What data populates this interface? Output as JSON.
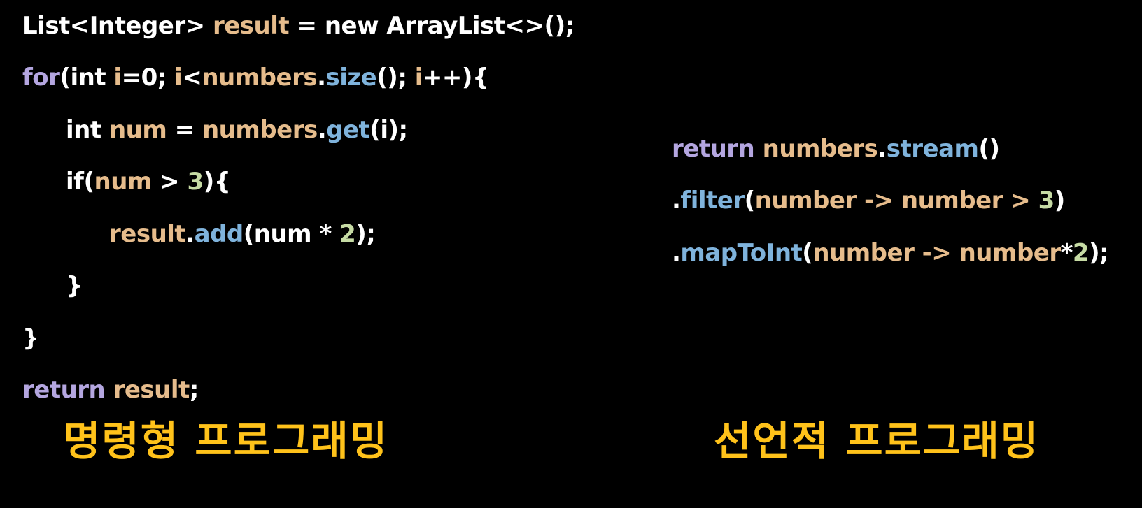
{
  "colors": {
    "background": "#000000",
    "plain": "#ffffff",
    "keyword": "#b4a6e0",
    "variable": "#e6bc8c",
    "method": "#7fb3dc",
    "number": "#c6dba4",
    "caption": "#ffc21a"
  },
  "imperative": {
    "lines": [
      [
        {
          "text": "List<Integer> ",
          "kind": "plain"
        },
        {
          "text": "result",
          "kind": "variable"
        },
        {
          "text": " = new ArrayList<>();",
          "kind": "plain"
        }
      ],
      [
        {
          "text": "for",
          "kind": "keyword"
        },
        {
          "text": "(int ",
          "kind": "plain"
        },
        {
          "text": "i",
          "kind": "variable"
        },
        {
          "text": "=0; ",
          "kind": "plain"
        },
        {
          "text": "i",
          "kind": "variable"
        },
        {
          "text": "<",
          "kind": "plain"
        },
        {
          "text": "numbers",
          "kind": "variable"
        },
        {
          "text": ".",
          "kind": "plain"
        },
        {
          "text": "size",
          "kind": "method"
        },
        {
          "text": "(); ",
          "kind": "plain"
        },
        {
          "text": "i",
          "kind": "variable"
        },
        {
          "text": "++){",
          "kind": "plain"
        }
      ],
      [
        {
          "text": "int ",
          "kind": "plain"
        },
        {
          "text": "num",
          "kind": "variable"
        },
        {
          "text": " = ",
          "kind": "plain"
        },
        {
          "text": "numbers",
          "kind": "variable"
        },
        {
          "text": ".",
          "kind": "plain"
        },
        {
          "text": "get",
          "kind": "method"
        },
        {
          "text": "(i);",
          "kind": "plain"
        }
      ],
      [
        {
          "text": "if(",
          "kind": "plain"
        },
        {
          "text": "num",
          "kind": "variable"
        },
        {
          "text": " > ",
          "kind": "plain"
        },
        {
          "text": "3",
          "kind": "number"
        },
        {
          "text": "){",
          "kind": "plain"
        }
      ],
      [
        {
          "text": "result",
          "kind": "variable"
        },
        {
          "text": ".",
          "kind": "plain"
        },
        {
          "text": "add",
          "kind": "method"
        },
        {
          "text": "(num * ",
          "kind": "plain"
        },
        {
          "text": "2",
          "kind": "number"
        },
        {
          "text": ");",
          "kind": "plain"
        }
      ],
      [
        {
          "text": "}",
          "kind": "plain"
        }
      ],
      [
        {
          "text": "}",
          "kind": "plain"
        }
      ],
      [
        {
          "text": "return ",
          "kind": "keyword"
        },
        {
          "text": "result",
          "kind": "variable"
        },
        {
          "text": ";",
          "kind": "plain"
        }
      ]
    ],
    "caption": "명령형 프로그래밍"
  },
  "declarative": {
    "lines": [
      [
        {
          "text": "return ",
          "kind": "keyword"
        },
        {
          "text": "numbers",
          "kind": "variable"
        },
        {
          "text": ".",
          "kind": "plain"
        },
        {
          "text": "stream",
          "kind": "method"
        },
        {
          "text": "()",
          "kind": "plain"
        }
      ],
      [
        {
          "text": ".",
          "kind": "plain"
        },
        {
          "text": "filter",
          "kind": "method"
        },
        {
          "text": "(",
          "kind": "plain"
        },
        {
          "text": "number -> number > ",
          "kind": "variable"
        },
        {
          "text": "3",
          "kind": "number"
        },
        {
          "text": ")",
          "kind": "plain"
        }
      ],
      [
        {
          "text": ".",
          "kind": "plain"
        },
        {
          "text": "mapToInt",
          "kind": "method"
        },
        {
          "text": "(",
          "kind": "plain"
        },
        {
          "text": "number -> number",
          "kind": "variable"
        },
        {
          "text": "*",
          "kind": "plain"
        },
        {
          "text": "2",
          "kind": "number"
        },
        {
          "text": ");",
          "kind": "plain"
        }
      ]
    ],
    "caption": "선언적 프로그래밍"
  }
}
